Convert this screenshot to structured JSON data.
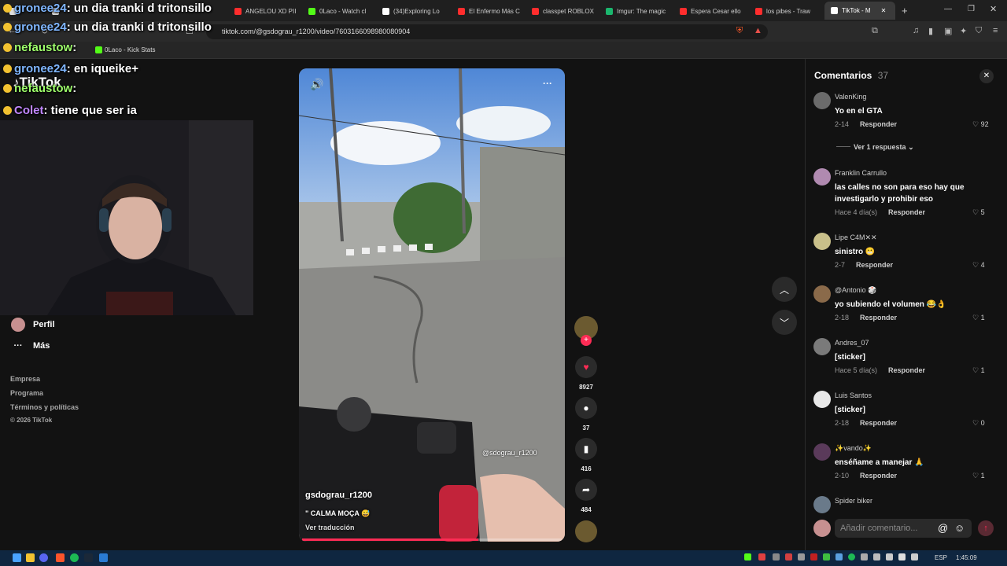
{
  "browser": {
    "tabs": [
      {
        "label": "",
        "color": "#e0e0e0"
      },
      {
        "label": "",
        "color": "#d9d9d9"
      },
      {
        "label": "ANGELOU XD PII",
        "color": "#ff2d2d"
      },
      {
        "label": "0Laco - Watch cl",
        "color": "#53fc18"
      },
      {
        "label": "(34)Exploring Lo",
        "color": "#ffffff"
      },
      {
        "label": "El Enfermo Más C",
        "color": "#ff2d2d"
      },
      {
        "label": "classpet ROBLOX",
        "color": "#ff2d2d"
      },
      {
        "label": "Imgur: The magic",
        "color": "#1bb76e"
      },
      {
        "label": "Espera Cesar ello",
        "color": "#ff2d2d"
      },
      {
        "label": "los pibes - Traw",
        "color": "#ff2d2d"
      },
      {
        "label": "TikTok - M",
        "color": "#ffffff"
      }
    ],
    "url": "tiktok.com/@gsdograu_r1200/video/7603166098980080904",
    "bookmark": "0Laco - Kick Stats"
  },
  "chat": [
    {
      "user": "gronee24",
      "message": ": un dia tranki d tritonsillo",
      "color": "user-blue"
    },
    {
      "user": "gronee24",
      "message": ": un dia tranki d tritonsillo",
      "color": "user-blue"
    },
    {
      "user": "nefaustow",
      "message": ":",
      "color": "user-green"
    },
    {
      "user": "gronee24",
      "message": ": en iqueike+",
      "color": "user-blue"
    },
    {
      "user": "nefaustow",
      "message": ":",
      "color": "user-green"
    },
    {
      "user": "Colet",
      "message": ": tiene que ser ia",
      "color": "user-purple"
    }
  ],
  "tiktok": {
    "logo": "TikTok",
    "sidebar": [
      {
        "label": "Perfil",
        "icon": "avatar"
      },
      {
        "label": "Más",
        "icon": "more-icon"
      }
    ],
    "footer": [
      "Empresa",
      "Programa",
      "Términos y políticas",
      "© 2026 TikTok"
    ]
  },
  "video": {
    "author": "gsdograu_r1200",
    "caption": "\" CALMA MOÇA 😅",
    "translate": "Ver traducción",
    "watermark": "@sdograu_r1200",
    "progress": 0.68
  },
  "actions": {
    "likes": "8927",
    "comments": "37",
    "saves": "416",
    "shares": "484"
  },
  "comments_panel": {
    "title": "Comentarios",
    "count": "37",
    "reply_label": "Responder",
    "more_replies": "Ver 1 respuesta",
    "input_placeholder": "Añadir comentario...",
    "items": [
      {
        "user": "ValenKing",
        "text": "Yo en el GTA",
        "date": "2-14",
        "likes": "92",
        "color": "#6b6b6b"
      },
      {
        "user": "Franklin Carrullo",
        "text": "las calles no son para eso hay que investigarlo y prohibir eso",
        "date": "Hace 4 día(s)",
        "likes": "5",
        "color": "#b08ab0"
      },
      {
        "user": "Lipe C4M✕✕",
        "text": "sinistro 😬",
        "date": "2-7",
        "likes": "4",
        "color": "#c9c08a"
      },
      {
        "user": "@Antonio 🎲",
        "text": "yo subiendo el volumen 😂👌",
        "date": "2-18",
        "likes": "1",
        "color": "#8a6a4a"
      },
      {
        "user": "Andres_07",
        "text": "[sticker]",
        "date": "Hace 5 día(s)",
        "likes": "1",
        "color": "#7a7a7a"
      },
      {
        "user": "Luis Santos",
        "text": "[sticker]",
        "date": "2-18",
        "likes": "0",
        "color": "#e8e8e8"
      },
      {
        "user": "✨vando✨",
        "text": "enséñame a manejar 🙏",
        "date": "2-10",
        "likes": "1",
        "color": "#5a3a5a"
      },
      {
        "user": "Spider biker",
        "text": "",
        "date": "",
        "likes": "",
        "color": "#6a7a8a"
      }
    ]
  },
  "taskbar": {
    "lang": "ESP",
    "time": "1:45:09"
  }
}
